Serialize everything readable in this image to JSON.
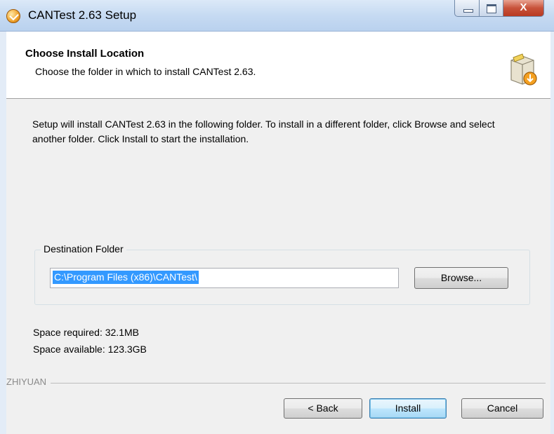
{
  "window": {
    "title": "CANTest 2.63 Setup",
    "close_label": "X"
  },
  "header": {
    "title": "Choose Install Location",
    "subtitle": "Choose the folder in which to install CANTest 2.63."
  },
  "main": {
    "description": "Setup will install CANTest 2.63 in the following folder. To install in a different folder, click Browse and select another folder. Click Install to start the installation."
  },
  "destination": {
    "legend": "Destination Folder",
    "path": "C:\\Program Files (x86)\\CANTest\\",
    "browse_label": "Browse..."
  },
  "space": {
    "required": "Space required: 32.1MB",
    "available": "Space available: 123.3GB"
  },
  "branding": "ZHIYUAN",
  "buttons": {
    "back": "< Back",
    "install": "Install",
    "cancel": "Cancel"
  },
  "colors": {
    "selection": "#3399ff",
    "titlebar": "#c6daf2",
    "close": "#c8523a"
  }
}
